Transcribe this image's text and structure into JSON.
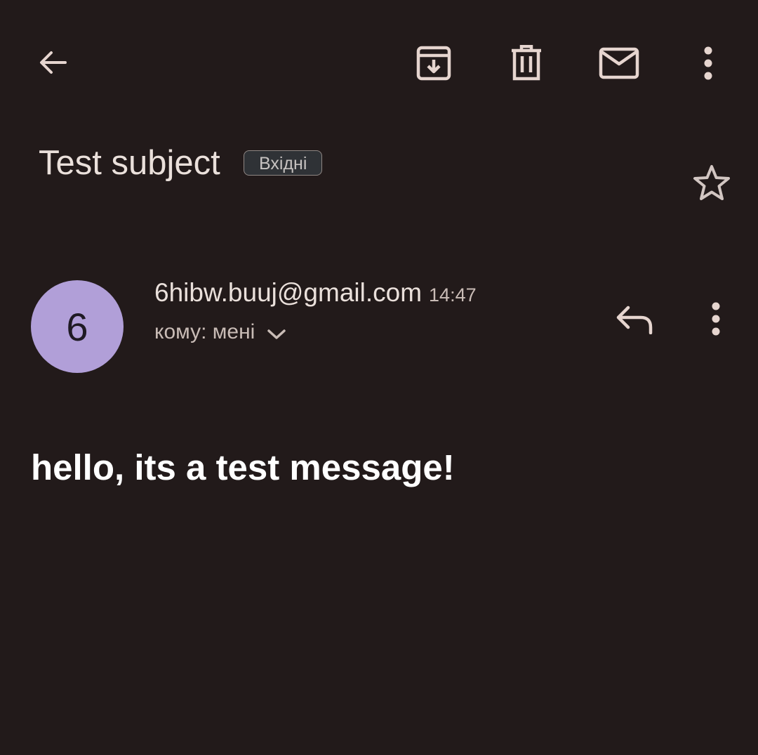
{
  "toolbar": {
    "back_icon": "arrow-back-icon",
    "archive_icon": "archive-icon",
    "delete_icon": "delete-icon",
    "mark_unread_icon": "mail-icon",
    "more_icon": "more-vert-icon"
  },
  "message": {
    "subject": "Test subject",
    "label": "Вхідні",
    "star_icon": "star-outline-icon"
  },
  "sender": {
    "avatar_letter": "6",
    "avatar_color": "#b19fd8",
    "email": "6hibw.buuj@gmail.com",
    "time": "14:47",
    "recipient": "кому: мені",
    "reply_icon": "reply-icon",
    "more_icon": "more-vert-icon"
  },
  "body": {
    "text": "hello, its a test message!"
  },
  "colors": {
    "background": "#221a1a",
    "icon": "#e6d5cf",
    "text": "#eae0db"
  }
}
